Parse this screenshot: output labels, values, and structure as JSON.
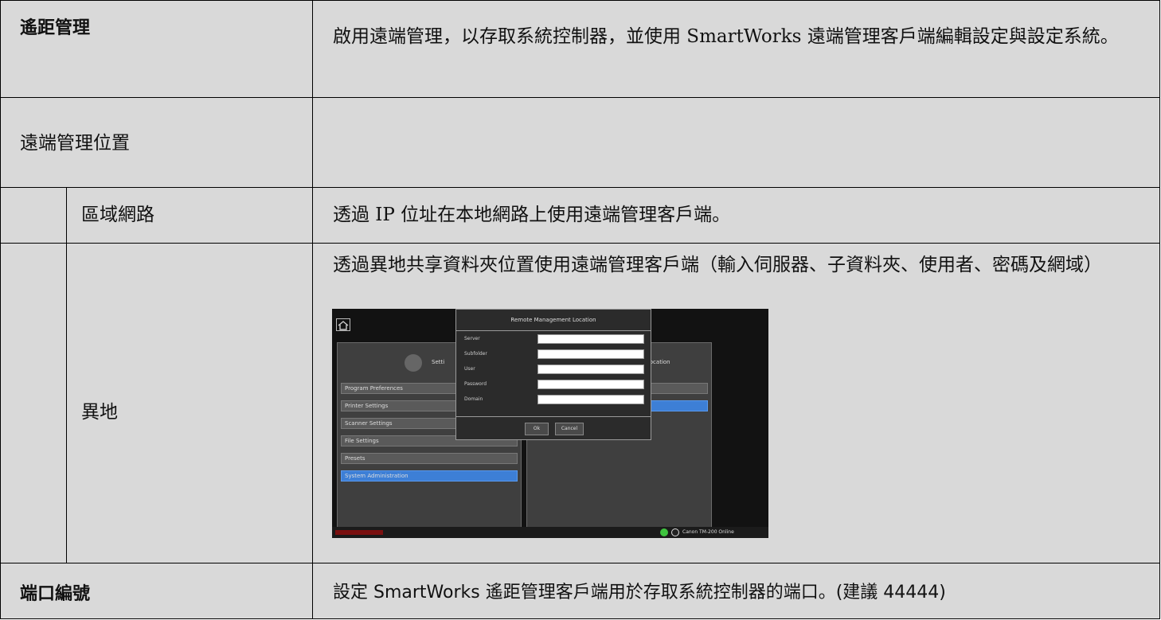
{
  "rows": [
    {
      "label": "遙距管理",
      "desc": "啟用遠端管理，以存取系統控制器，並使用 SmartWorks 遠端管理客戶端編輯設定與設定系統。"
    },
    {
      "label": "遠端管理位置",
      "desc": ""
    },
    {
      "label": "區域網路",
      "desc": "透過 IP 位址在本地網路上使用遠端管理客戶端。"
    },
    {
      "label": "異地",
      "desc": "透過異地共享資料夾位置使用遠端管理客戶端（輸入伺服器、子資料夾、使用者、密碼及網域）"
    },
    {
      "label": "端口編號",
      "desc": "設定 SmartWorks 遙距管理客戶端用於存取系統控制器的端口。(建議 44444)"
    }
  ],
  "screenshot": {
    "menu_items": [
      "Program Preferences",
      "Printer Settings",
      "Scanner Settings",
      "File Settings",
      "Presets",
      "System Administration"
    ],
    "settings_label": "Setti",
    "right_title": "Location",
    "dialog": {
      "title": "Remote Management Location",
      "fields": [
        "Server",
        "Subfolder",
        "User",
        "Password",
        "Domain"
      ],
      "ok": "Ok",
      "cancel": "Cancel"
    },
    "status": "Canon TM-200 Online"
  }
}
